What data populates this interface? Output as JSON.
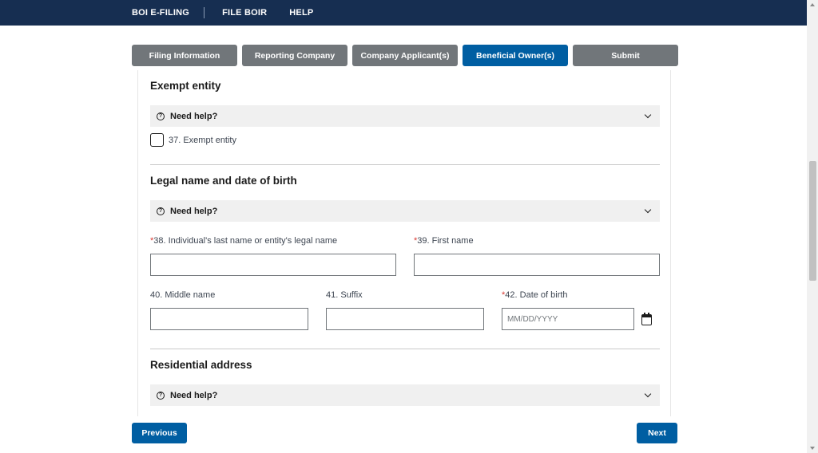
{
  "topnav": {
    "brand": "BOI E-FILING",
    "file_link": "FILE BOIR",
    "help_link": "HELP"
  },
  "steps": [
    {
      "label": "Filing Information",
      "active": false
    },
    {
      "label": "Reporting Company",
      "active": false
    },
    {
      "label": "Company Applicant(s)",
      "active": false
    },
    {
      "label": "Beneficial Owner(s)",
      "active": true
    },
    {
      "label": "Submit",
      "active": false
    }
  ],
  "help_label": "Need help?",
  "exempt": {
    "title": "Exempt entity",
    "checkbox_label": "37. Exempt entity",
    "checked": false
  },
  "legal": {
    "title": "Legal name and date of birth",
    "last_name_label": "38. Individual's last name or entity's legal name",
    "last_name_value": "",
    "first_name_label": "39. First name",
    "first_name_value": "",
    "middle_name_label": "40. Middle name",
    "middle_name_value": "",
    "suffix_label": "41. Suffix",
    "suffix_value": "",
    "dob_label": "42. Date of birth",
    "dob_placeholder": "MM/DD/YYYY",
    "dob_value": ""
  },
  "residential": {
    "title": "Residential address"
  },
  "footer": {
    "previous": "Previous",
    "next": "Next"
  },
  "colors": {
    "navy": "#162e51",
    "primary": "#005ea2",
    "step_inactive": "#71767a",
    "required": "#d83933"
  }
}
